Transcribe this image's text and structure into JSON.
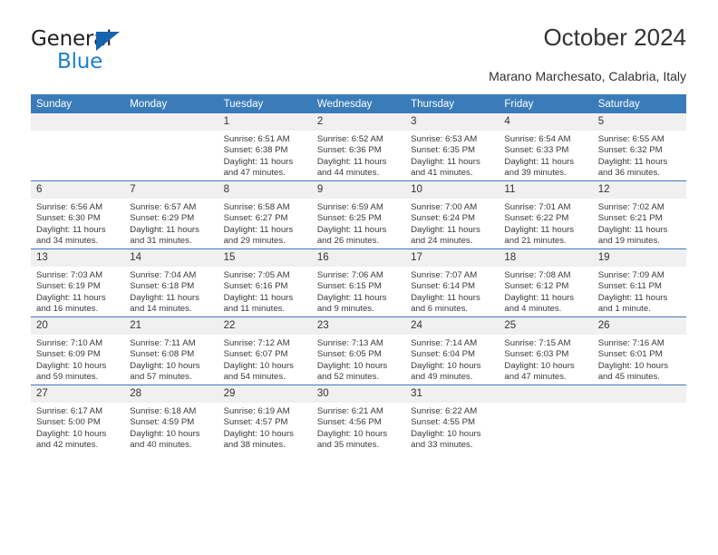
{
  "brand": {
    "name_top": "General",
    "name_bottom": "Blue",
    "triangle_color": "#1464ae",
    "blue_color": "#1c7fd0"
  },
  "header": {
    "title": "October 2024",
    "subtitle": "Marano Marchesato, Calabria, Italy"
  },
  "calendar": {
    "header_bg": "#3a7cba",
    "daynum_bg": "#f0f0f0",
    "weekday_headers": [
      "Sunday",
      "Monday",
      "Tuesday",
      "Wednesday",
      "Thursday",
      "Friday",
      "Saturday"
    ],
    "weeks": [
      [
        {
          "day": "",
          "sunrise": "",
          "sunset": "",
          "daylight": ""
        },
        {
          "day": "",
          "sunrise": "",
          "sunset": "",
          "daylight": ""
        },
        {
          "day": "1",
          "sunrise": "Sunrise: 6:51 AM",
          "sunset": "Sunset: 6:38 PM",
          "daylight": "Daylight: 11 hours and 47 minutes."
        },
        {
          "day": "2",
          "sunrise": "Sunrise: 6:52 AM",
          "sunset": "Sunset: 6:36 PM",
          "daylight": "Daylight: 11 hours and 44 minutes."
        },
        {
          "day": "3",
          "sunrise": "Sunrise: 6:53 AM",
          "sunset": "Sunset: 6:35 PM",
          "daylight": "Daylight: 11 hours and 41 minutes."
        },
        {
          "day": "4",
          "sunrise": "Sunrise: 6:54 AM",
          "sunset": "Sunset: 6:33 PM",
          "daylight": "Daylight: 11 hours and 39 minutes."
        },
        {
          "day": "5",
          "sunrise": "Sunrise: 6:55 AM",
          "sunset": "Sunset: 6:32 PM",
          "daylight": "Daylight: 11 hours and 36 minutes."
        }
      ],
      [
        {
          "day": "6",
          "sunrise": "Sunrise: 6:56 AM",
          "sunset": "Sunset: 6:30 PM",
          "daylight": "Daylight: 11 hours and 34 minutes."
        },
        {
          "day": "7",
          "sunrise": "Sunrise: 6:57 AM",
          "sunset": "Sunset: 6:29 PM",
          "daylight": "Daylight: 11 hours and 31 minutes."
        },
        {
          "day": "8",
          "sunrise": "Sunrise: 6:58 AM",
          "sunset": "Sunset: 6:27 PM",
          "daylight": "Daylight: 11 hours and 29 minutes."
        },
        {
          "day": "9",
          "sunrise": "Sunrise: 6:59 AM",
          "sunset": "Sunset: 6:25 PM",
          "daylight": "Daylight: 11 hours and 26 minutes."
        },
        {
          "day": "10",
          "sunrise": "Sunrise: 7:00 AM",
          "sunset": "Sunset: 6:24 PM",
          "daylight": "Daylight: 11 hours and 24 minutes."
        },
        {
          "day": "11",
          "sunrise": "Sunrise: 7:01 AM",
          "sunset": "Sunset: 6:22 PM",
          "daylight": "Daylight: 11 hours and 21 minutes."
        },
        {
          "day": "12",
          "sunrise": "Sunrise: 7:02 AM",
          "sunset": "Sunset: 6:21 PM",
          "daylight": "Daylight: 11 hours and 19 minutes."
        }
      ],
      [
        {
          "day": "13",
          "sunrise": "Sunrise: 7:03 AM",
          "sunset": "Sunset: 6:19 PM",
          "daylight": "Daylight: 11 hours and 16 minutes."
        },
        {
          "day": "14",
          "sunrise": "Sunrise: 7:04 AM",
          "sunset": "Sunset: 6:18 PM",
          "daylight": "Daylight: 11 hours and 14 minutes."
        },
        {
          "day": "15",
          "sunrise": "Sunrise: 7:05 AM",
          "sunset": "Sunset: 6:16 PM",
          "daylight": "Daylight: 11 hours and 11 minutes."
        },
        {
          "day": "16",
          "sunrise": "Sunrise: 7:06 AM",
          "sunset": "Sunset: 6:15 PM",
          "daylight": "Daylight: 11 hours and 9 minutes."
        },
        {
          "day": "17",
          "sunrise": "Sunrise: 7:07 AM",
          "sunset": "Sunset: 6:14 PM",
          "daylight": "Daylight: 11 hours and 6 minutes."
        },
        {
          "day": "18",
          "sunrise": "Sunrise: 7:08 AM",
          "sunset": "Sunset: 6:12 PM",
          "daylight": "Daylight: 11 hours and 4 minutes."
        },
        {
          "day": "19",
          "sunrise": "Sunrise: 7:09 AM",
          "sunset": "Sunset: 6:11 PM",
          "daylight": "Daylight: 11 hours and 1 minute."
        }
      ],
      [
        {
          "day": "20",
          "sunrise": "Sunrise: 7:10 AM",
          "sunset": "Sunset: 6:09 PM",
          "daylight": "Daylight: 10 hours and 59 minutes."
        },
        {
          "day": "21",
          "sunrise": "Sunrise: 7:11 AM",
          "sunset": "Sunset: 6:08 PM",
          "daylight": "Daylight: 10 hours and 57 minutes."
        },
        {
          "day": "22",
          "sunrise": "Sunrise: 7:12 AM",
          "sunset": "Sunset: 6:07 PM",
          "daylight": "Daylight: 10 hours and 54 minutes."
        },
        {
          "day": "23",
          "sunrise": "Sunrise: 7:13 AM",
          "sunset": "Sunset: 6:05 PM",
          "daylight": "Daylight: 10 hours and 52 minutes."
        },
        {
          "day": "24",
          "sunrise": "Sunrise: 7:14 AM",
          "sunset": "Sunset: 6:04 PM",
          "daylight": "Daylight: 10 hours and 49 minutes."
        },
        {
          "day": "25",
          "sunrise": "Sunrise: 7:15 AM",
          "sunset": "Sunset: 6:03 PM",
          "daylight": "Daylight: 10 hours and 47 minutes."
        },
        {
          "day": "26",
          "sunrise": "Sunrise: 7:16 AM",
          "sunset": "Sunset: 6:01 PM",
          "daylight": "Daylight: 10 hours and 45 minutes."
        }
      ],
      [
        {
          "day": "27",
          "sunrise": "Sunrise: 6:17 AM",
          "sunset": "Sunset: 5:00 PM",
          "daylight": "Daylight: 10 hours and 42 minutes."
        },
        {
          "day": "28",
          "sunrise": "Sunrise: 6:18 AM",
          "sunset": "Sunset: 4:59 PM",
          "daylight": "Daylight: 10 hours and 40 minutes."
        },
        {
          "day": "29",
          "sunrise": "Sunrise: 6:19 AM",
          "sunset": "Sunset: 4:57 PM",
          "daylight": "Daylight: 10 hours and 38 minutes."
        },
        {
          "day": "30",
          "sunrise": "Sunrise: 6:21 AM",
          "sunset": "Sunset: 4:56 PM",
          "daylight": "Daylight: 10 hours and 35 minutes."
        },
        {
          "day": "31",
          "sunrise": "Sunrise: 6:22 AM",
          "sunset": "Sunset: 4:55 PM",
          "daylight": "Daylight: 10 hours and 33 minutes."
        },
        {
          "day": "",
          "sunrise": "",
          "sunset": "",
          "daylight": ""
        },
        {
          "day": "",
          "sunrise": "",
          "sunset": "",
          "daylight": ""
        }
      ]
    ]
  }
}
